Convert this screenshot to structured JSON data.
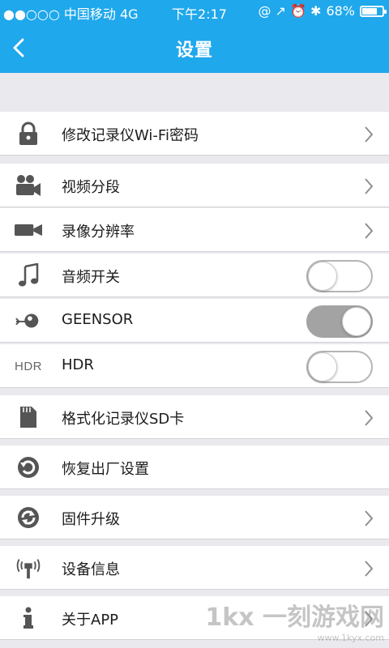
{
  "status_bar": {
    "carrier": "●●○○○ 中国移动 4G",
    "time": "下午2:17",
    "indicators": "@ ↗ ⏰ ✱",
    "battery_percent": "68%",
    "battery_level": 0.68
  },
  "nav": {
    "back_icon": "chevron-left-icon",
    "title": "设置"
  },
  "settings": {
    "wifi_password": {
      "label": "修改记录仪Wi-Fi密码",
      "icon": "lock-icon"
    },
    "video_segment": {
      "label": "视频分段",
      "icon": "video-camera-icon"
    },
    "resolution": {
      "label": "录像分辨率",
      "icon": "camcorder-icon"
    },
    "audio_switch": {
      "label": "音频开关",
      "icon": "music-note-icon",
      "enabled": false
    },
    "gsensor": {
      "label": "GEENSOR",
      "icon": "sensor-icon",
      "enabled": true
    },
    "hdr": {
      "label": "HDR",
      "icon_text": "HDR",
      "enabled": false
    },
    "format_sd": {
      "label": "格式化记录仪SD卡",
      "icon": "sd-card-icon"
    },
    "factory_reset": {
      "label": "恢复出厂设置",
      "icon": "reset-icon"
    },
    "firmware_upgrade": {
      "label": "固件升级",
      "icon": "refresh-icon"
    },
    "device_info": {
      "label": "设备信息",
      "icon": "antenna-icon"
    },
    "about_app": {
      "label": "关于APP",
      "icon": "info-icon"
    }
  },
  "colors": {
    "header": "#1fa8ec",
    "background": "#e9e9ee",
    "icon_gray": "#555555"
  },
  "watermark": {
    "text": "1kx 一刻游戏网",
    "url_text": "www.1kyx.com"
  }
}
